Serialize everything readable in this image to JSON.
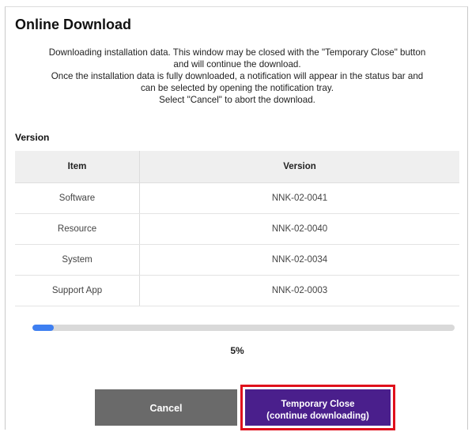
{
  "dialog": {
    "title": "Online Download",
    "message_lines": [
      "Downloading installation data. This window may be closed with the \"Temporary Close\" button",
      "and will continue the download.",
      "Once the installation data is fully downloaded, a notification will appear in the status bar and",
      "can be selected by opening the notification tray.",
      "Select \"Cancel\" to abort the download."
    ]
  },
  "version_section": {
    "label": "Version",
    "columns": [
      "Item",
      "Version"
    ],
    "rows": [
      {
        "item": "Software",
        "version": "NNK-02-0041"
      },
      {
        "item": "Resource",
        "version": "NNK-02-0040"
      },
      {
        "item": "System",
        "version": "NNK-02-0034"
      },
      {
        "item": "Support App",
        "version": "NNK-02-0003"
      }
    ]
  },
  "progress": {
    "value_fraction": 0.05,
    "label": "5%",
    "fill_color": "#3e7ff1",
    "track_color": "#d9d9d9"
  },
  "buttons": {
    "cancel_label": "Cancel",
    "temporary_close_line1": "Temporary Close",
    "temporary_close_line2": "(continue downloading)",
    "cancel_color": "#6a6a6a",
    "temporary_close_color": "#4a1f8c",
    "highlight_color": "#e0101c"
  }
}
